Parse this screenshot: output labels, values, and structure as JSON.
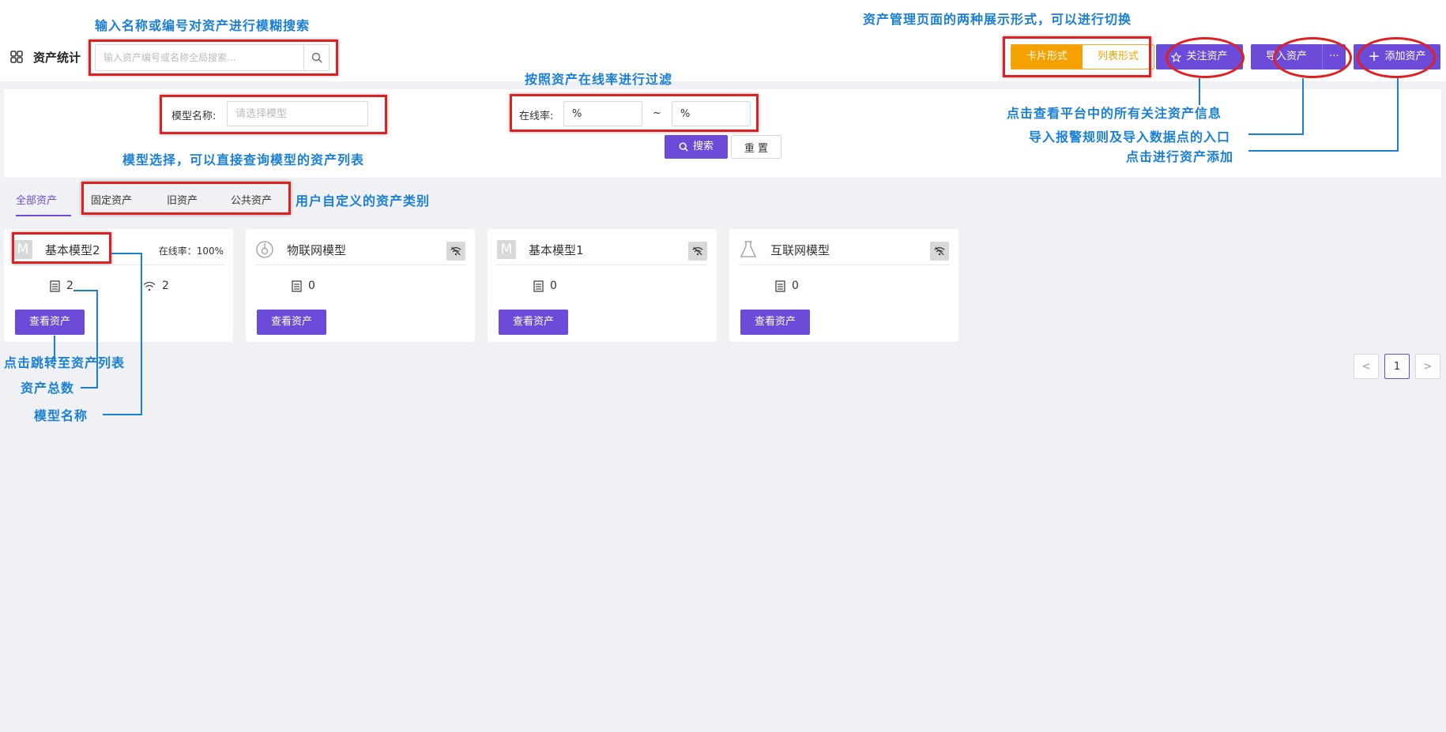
{
  "header": {
    "title": "资产统计",
    "search_placeholder": "输入资产编号或名称全局搜索...",
    "view_card": "卡片形式",
    "view_list": "列表形式",
    "follow_btn": "关注资产",
    "import_btn": "导入资产",
    "more_btn": "···",
    "add_btn": "添加资产"
  },
  "filters": {
    "model_label": "模型名称:",
    "model_placeholder": "请选择模型",
    "rate_label": "在线率:",
    "rate_min": "%",
    "rate_sep": "~",
    "rate_max": "%",
    "search_btn": "搜索",
    "reset_btn": "重 置"
  },
  "tabs": [
    {
      "label": "全部资产",
      "active": true
    },
    {
      "label": "固定资产",
      "active": false
    },
    {
      "label": "旧资产",
      "active": false
    },
    {
      "label": "公共资产",
      "active": false
    }
  ],
  "cards": [
    {
      "name": "基本模型2",
      "icon": "letter-m-icon",
      "rate_label": "在线率：100%",
      "total": "2",
      "online": "2",
      "button": "查看资产"
    },
    {
      "name": "物联网模型",
      "icon": "iot-icon",
      "total": "0",
      "button": "查看资产"
    },
    {
      "name": "基本模型1",
      "icon": "letter-m-icon",
      "total": "0",
      "button": "查看资产"
    },
    {
      "name": "互联网模型",
      "icon": "flask-icon",
      "total": "0",
      "button": "查看资产"
    }
  ],
  "pagination": {
    "current": "1",
    "prev": "<",
    "next": ">"
  },
  "annotations": {
    "search": "输入名称或编号对资产进行模糊搜索",
    "view_mode": "资产管理页面的两种展示形式，可以进行切换",
    "rate_filter": "按照资产在线率进行过滤",
    "model_select": "模型选择，可以直接查询模型的资产列表",
    "follow": "点击查看平台中的所有关注资产信息",
    "import": "导入报警规则及导入数据点的入口",
    "add": "点击进行资产添加",
    "categories": "用户自定义的资产类别",
    "view_assets": "点击跳转至资产列表",
    "total_count": "资产总数",
    "model_name": "模型名称"
  },
  "colors": {
    "primary": "#6b4bd8",
    "orange": "#f5a100",
    "annotation": "#1a7fd6",
    "highlight": "#e02020"
  }
}
